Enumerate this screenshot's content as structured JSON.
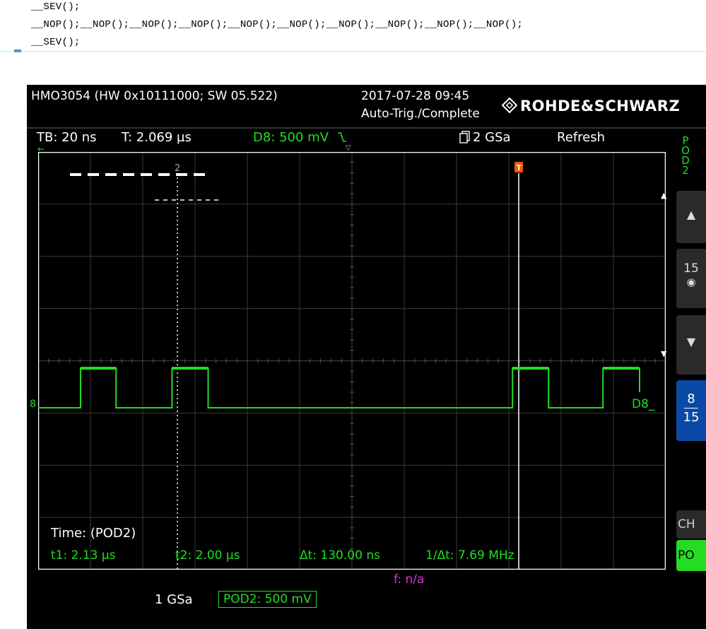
{
  "code": {
    "line1": "__SEV();",
    "line2": "__NOP();__NOP();__NOP();__NOP();__NOP();__NOP();__NOP();__NOP();__NOP();__NOP();",
    "line3": "__SEV();"
  },
  "header": {
    "title": "HMO3054 (HW 0x10111000; SW 05.522)",
    "datetime": "2017-07-28 09:45",
    "trigger_status": "Auto-Trig./Complete",
    "brand": "ROHDE&SCHWARZ"
  },
  "info_bar": {
    "timebase": "TB: 20 ns",
    "trigger_pos": "T: 2.069 µs",
    "trigger_source": "D8: 500 mV",
    "sample_rate": "2 GSa",
    "mode": "Refresh",
    "pod_label": "POD2"
  },
  "markers": {
    "cursor2_label": "2",
    "trigger_label": "T",
    "channel_left": "8",
    "channel_right": "D8_"
  },
  "side_panel": {
    "scroll_value": "15",
    "ch_current": "8",
    "ch_total": "15",
    "ch_label": "CH",
    "po_label": "PO"
  },
  "measurements": {
    "title": "Time: (POD2)",
    "t1": "t1: 2.13 µs",
    "t2": "t2: 2.00 µs",
    "dt": "Δt: 130.00 ns",
    "inv_dt": "1/Δt: 7.69 MHz"
  },
  "bottom": {
    "freq": "f: n/a",
    "acq_rate": "1 GSa",
    "pod_setting": "POD2: 500 mV"
  },
  "colors": {
    "trace": "#22dd22",
    "trigger_marker": "#ff5500",
    "freq": "#dd33dd",
    "accent_blue": "#0a4aa6"
  },
  "waveform": {
    "time_divisions": 12,
    "ns_per_division": 20,
    "pulses": [
      {
        "rise_div": 0.81,
        "fall_div": 1.49
      },
      {
        "rise_div": 2.56,
        "fall_div": 3.25
      },
      {
        "rise_div": 9.07,
        "fall_div": 9.76
      },
      {
        "rise_div": 10.8,
        "fall_div": 11.5
      }
    ]
  }
}
